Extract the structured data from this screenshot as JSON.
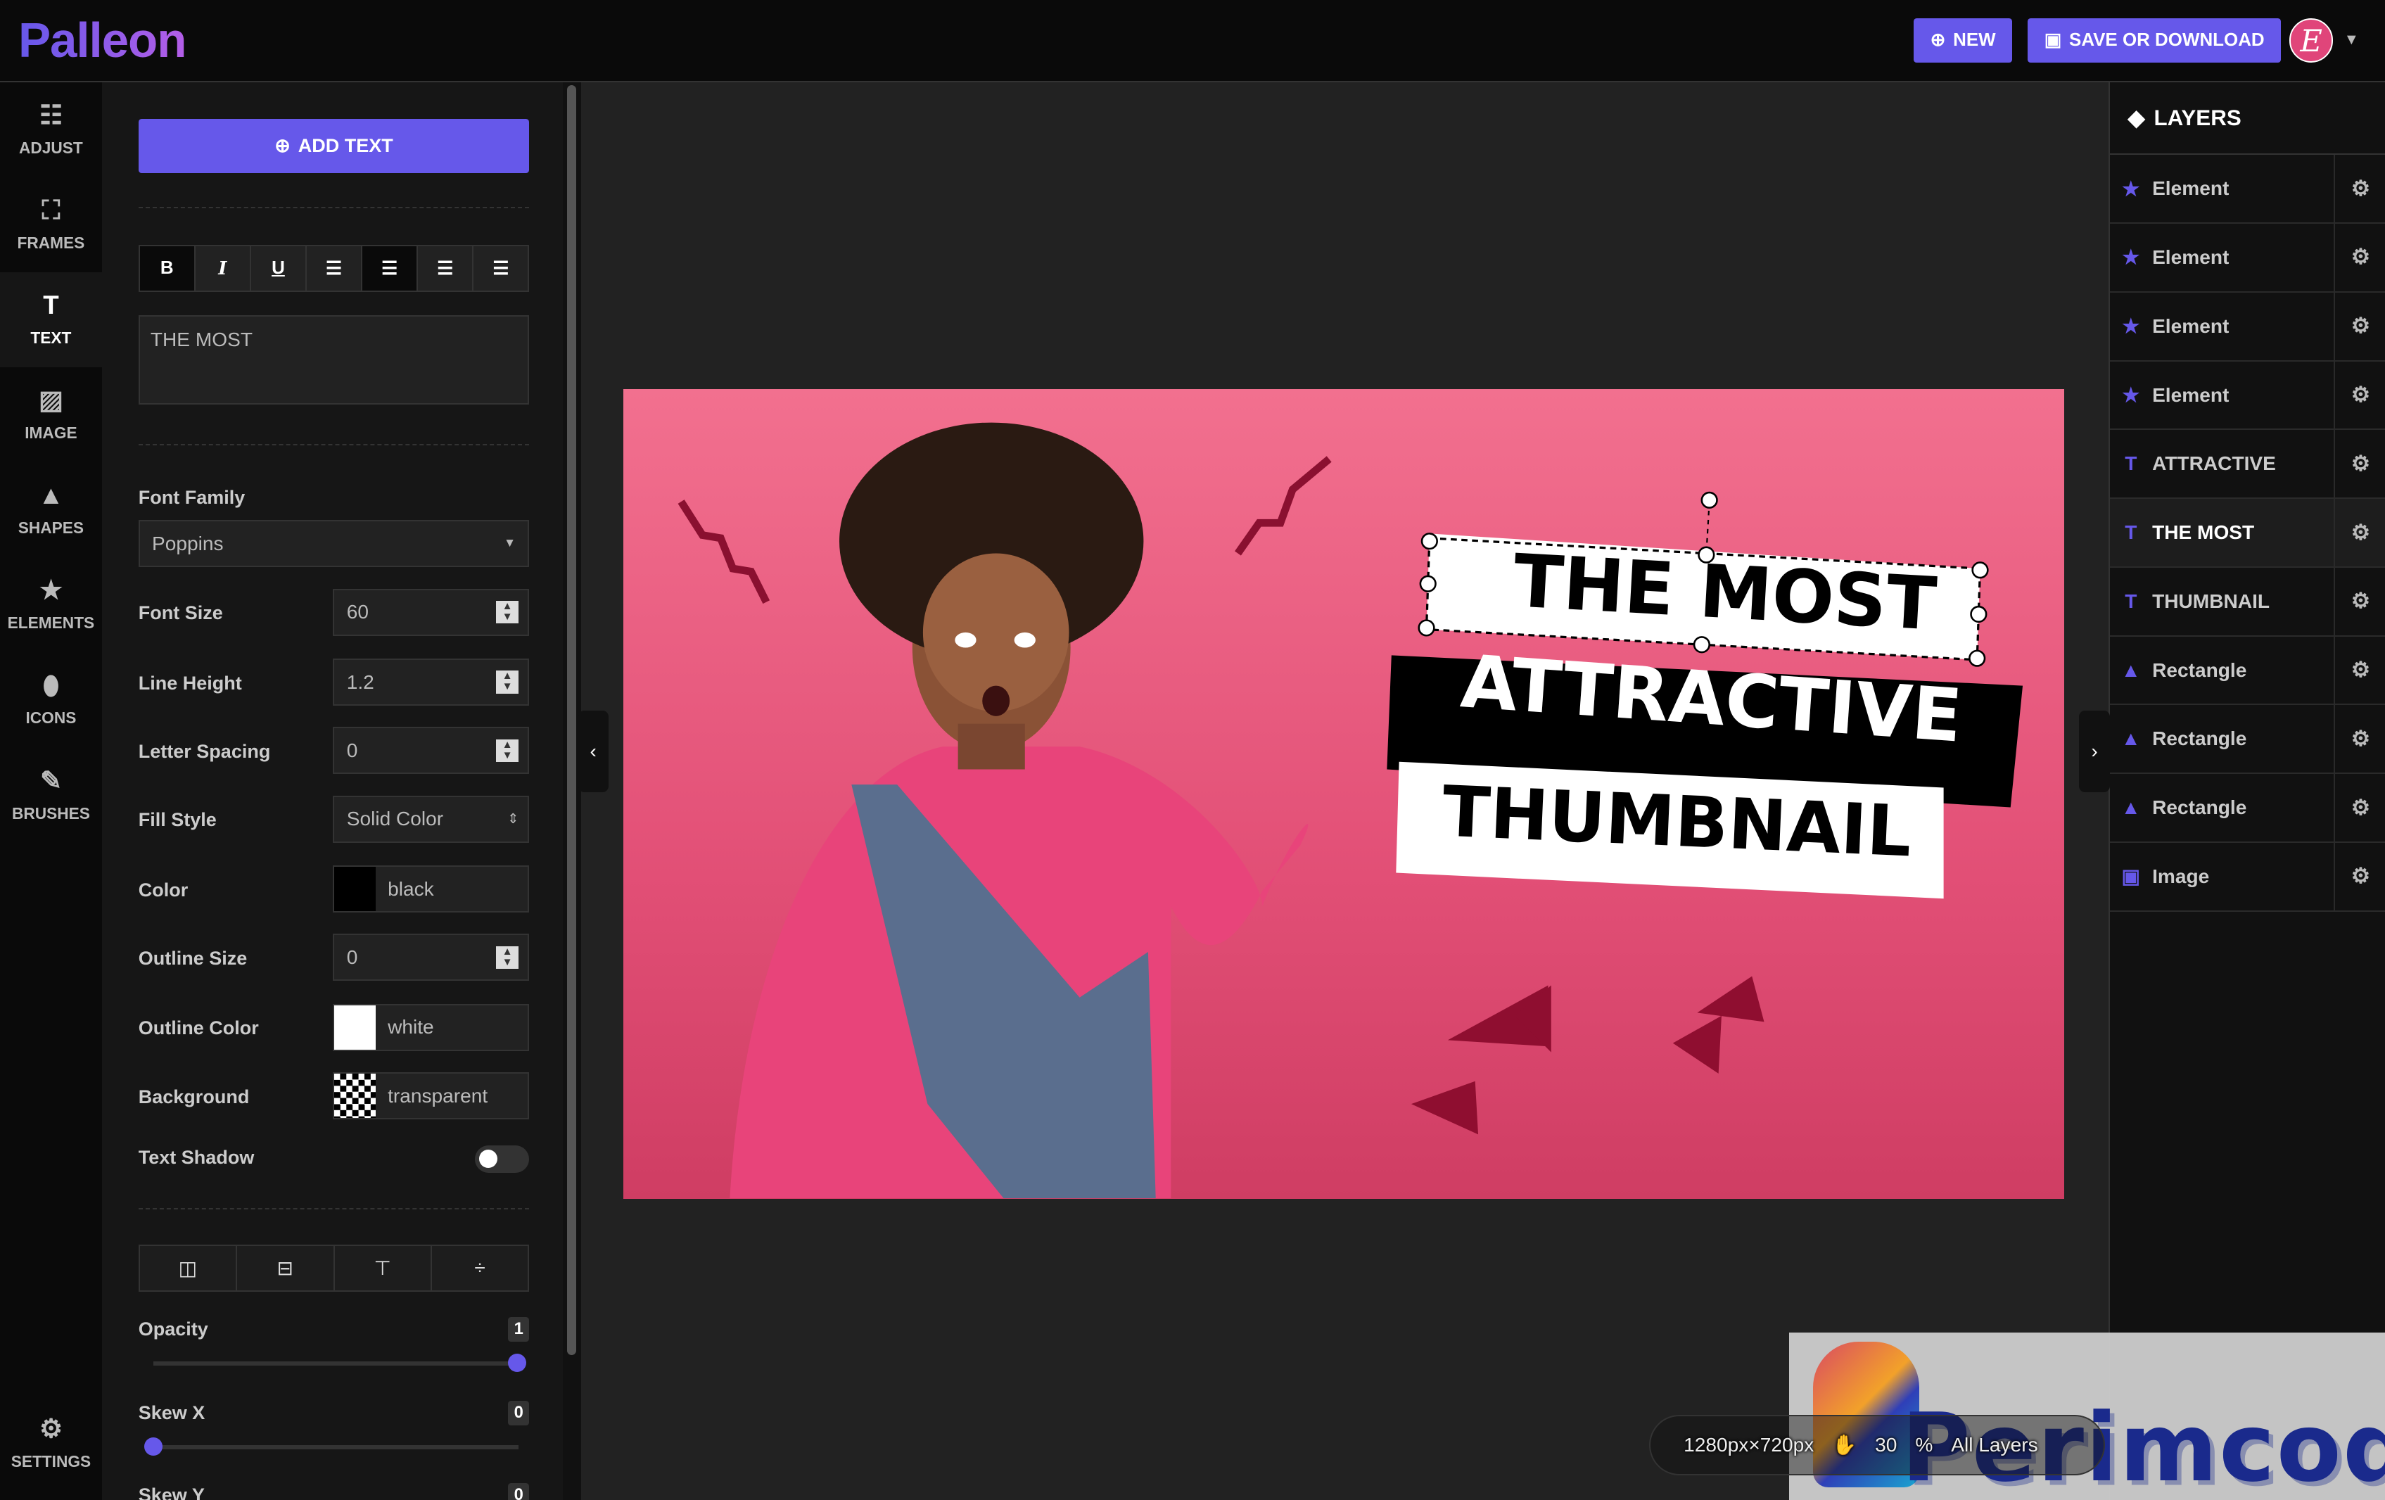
{
  "app": {
    "logo": "Palleon",
    "new_label": "NEW",
    "save_label": "SAVE OR DOWNLOAD",
    "avatar_letter": "E",
    "accent": "#6658ea"
  },
  "nav": {
    "items": [
      {
        "label": "ADJUST",
        "icon": "sliders-icon"
      },
      {
        "label": "FRAMES",
        "icon": "frame-icon"
      },
      {
        "label": "TEXT",
        "icon": "text-icon",
        "active": true
      },
      {
        "label": "IMAGE",
        "icon": "image-add-icon"
      },
      {
        "label": "SHAPES",
        "icon": "shapes-icon"
      },
      {
        "label": "ELEMENTS",
        "icon": "star-icon"
      },
      {
        "label": "ICONS",
        "icon": "pin-icon"
      },
      {
        "label": "BRUSHES",
        "icon": "brush-icon"
      }
    ],
    "settings": "SETTINGS"
  },
  "panel": {
    "add_text": "ADD TEXT",
    "format_buttons": [
      "B",
      "I",
      "U"
    ],
    "text_value": "THE MOST",
    "font_family_label": "Font Family",
    "font_family": "Poppins",
    "font_size_label": "Font Size",
    "font_size": "60",
    "line_height_label": "Line Height",
    "line_height": "1.2",
    "letter_spacing_label": "Letter Spacing",
    "letter_spacing": "0",
    "fill_style_label": "Fill Style",
    "fill_style": "Solid Color",
    "color_label": "Color",
    "color": "black",
    "outline_size_label": "Outline Size",
    "outline_size": "0",
    "outline_color_label": "Outline Color",
    "outline_color": "white",
    "background_label": "Background",
    "background": "transparent",
    "text_shadow_label": "Text Shadow",
    "text_shadow": false,
    "opacity_label": "Opacity",
    "opacity": "1",
    "skew_x_label": "Skew X",
    "skew_x": "0",
    "skew_y_label": "Skew Y",
    "skew_y": "0"
  },
  "canvas": {
    "line1": "THE MOST",
    "line2": "ATTRACTIVE",
    "line3": "THUMBNAIL",
    "size": "1280px",
    "size2": "720px",
    "zoom": "30",
    "zoom_unit": "%",
    "layer_filter": "All Layers"
  },
  "layers": {
    "title": "LAYERS",
    "items": [
      {
        "name": "Element",
        "type": "star-icon"
      },
      {
        "name": "Element",
        "type": "star-icon"
      },
      {
        "name": "Element",
        "type": "star-icon"
      },
      {
        "name": "Element",
        "type": "star-icon"
      },
      {
        "name": "ATTRACTIVE",
        "type": "text-icon"
      },
      {
        "name": "THE MOST",
        "type": "text-icon",
        "selected": true
      },
      {
        "name": "THUMBNAIL",
        "type": "text-icon"
      },
      {
        "name": "Rectangle",
        "type": "shapes-icon"
      },
      {
        "name": "Rectangle",
        "type": "shapes-icon"
      },
      {
        "name": "Rectangle",
        "type": "shapes-icon"
      },
      {
        "name": "Image",
        "type": "image-icon"
      }
    ]
  },
  "watermark": "Perimcode"
}
